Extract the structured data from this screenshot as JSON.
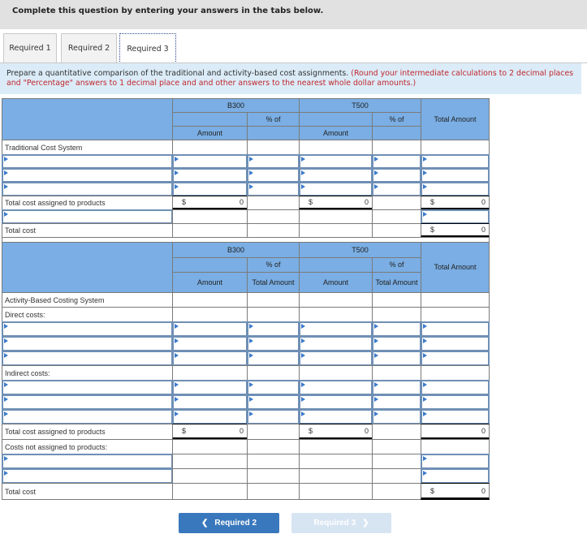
{
  "header": {
    "prompt": "Complete this question by entering your answers in the tabs below."
  },
  "tabs": [
    {
      "label": "Required 1",
      "active": false
    },
    {
      "label": "Required 2",
      "active": false
    },
    {
      "label": "Required 3",
      "active": true
    }
  ],
  "instructions": {
    "text": "Prepare a quantitative comparison of the traditional and activity-based cost assignments.",
    "note": "(Round your intermediate calculations to 2 decimal places and \"Percentage\" answers to 1 decimal place and and other answers to the nearest whole dollar amounts.)"
  },
  "table": {
    "product1": "B300",
    "product2": "T500",
    "amount": "Amount",
    "pct_of": "% of",
    "pct_total_amount": "Total Amount",
    "total_amount": "Total Amount",
    "traditional": {
      "title": "Traditional Cost System",
      "total_assigned_label": "Total cost assigned to products",
      "total_cost_label": "Total cost",
      "currency": "$",
      "b300_total": "0",
      "t500_total": "0",
      "total_amount_total": "0",
      "total_cost_value": "0"
    },
    "abc": {
      "title": "Activity-Based Costing System",
      "direct_label": "Direct costs:",
      "indirect_label": "Indirect costs:",
      "total_assigned_label": "Total cost assigned to products",
      "not_assigned_label": "Costs not assigned to products:",
      "total_cost_label": "Total cost",
      "currency": "$",
      "b300_total": "0",
      "t500_total": "0",
      "total_amount_total": "0",
      "total_cost_value": "0"
    }
  },
  "nav": {
    "prev_label": "Required 2",
    "next_label": "Required 3",
    "prev_icon": "chevron-left-icon",
    "next_icon": "chevron-right-icon"
  }
}
